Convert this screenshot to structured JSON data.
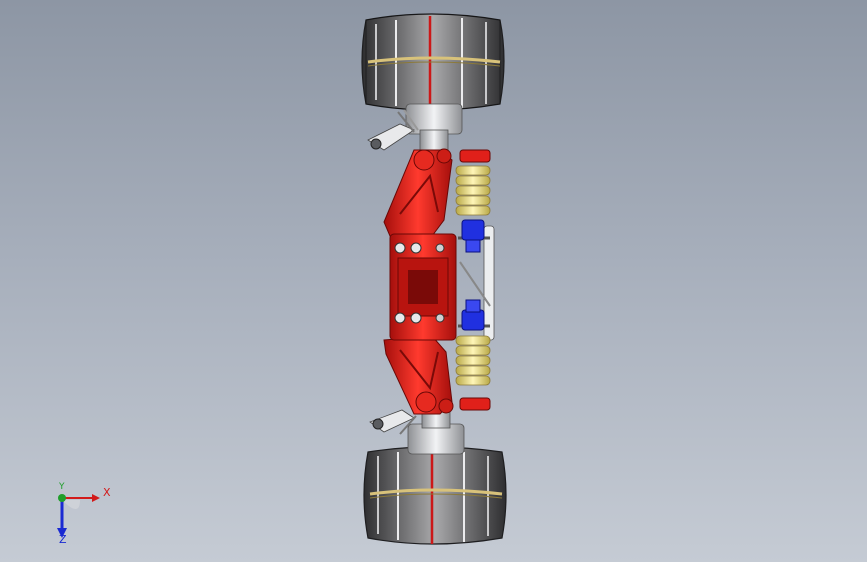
{
  "app": {
    "window_title": ""
  },
  "view": {
    "background_top": "#8d96a4",
    "background_bottom": "#c5cbd4",
    "model": {
      "colors": {
        "frame_red": "#e0201a",
        "frame_dark_red": "#9a0e0c",
        "tire_dark": "#3a3a3c",
        "tire_light": "#9a9a9c",
        "tread_gold": "#d8c27a",
        "tread_red": "#d01818",
        "hub_silver": "#d8dadd",
        "spring_yellow": "#f0e48a",
        "shock_blue": "#2030e0"
      }
    }
  },
  "triad": {
    "x_label": "X",
    "y_label": "Y",
    "z_label": "Z",
    "colors": {
      "x": "#d21a1a",
      "y": "#1f9e2a",
      "z": "#1a2ad2"
    }
  }
}
